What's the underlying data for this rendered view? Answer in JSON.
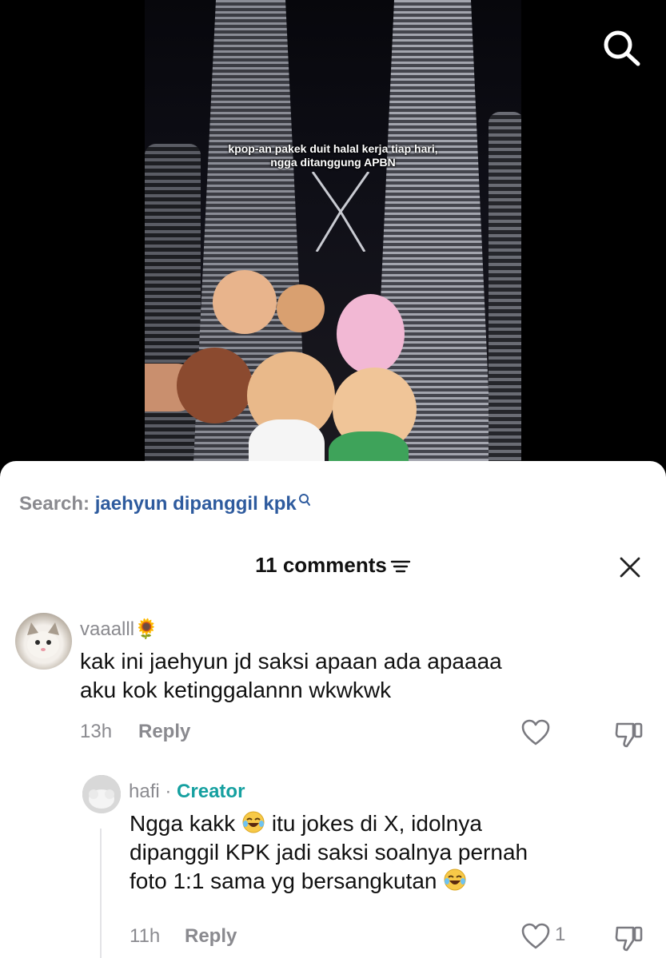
{
  "video": {
    "caption_line1": "kpop-an pakek duit halal kerja tiap hari,",
    "caption_line2": "ngga ditanggung APBN"
  },
  "search": {
    "prefix": "Search:",
    "query": "jaehyun dipanggil kpk"
  },
  "comments_header": {
    "title": "11 comments"
  },
  "comments": [
    {
      "username": "vaaalll",
      "username_emoji": "🌻",
      "text_line1": "kak ini jaehyun jd saksi apaan ada apaaaa",
      "text_line2": "aku kok ketinggalannn wkwkwk",
      "time": "13h",
      "reply_label": "Reply"
    },
    {
      "username": "hafi",
      "separator": "·",
      "badge": "Creator",
      "text_part1": "Ngga kakk",
      "text_part2": "itu jokes di X, idolnya",
      "text_line2": "dipanggil KPK jadi saksi soalnya pernah",
      "text_line3": "foto 1:1 sama yg bersangkutan",
      "time": "11h",
      "reply_label": "Reply",
      "like_count": "1"
    }
  ],
  "icons": {
    "search": "search-icon",
    "filter": "sort-lines-icon",
    "close": "close-icon",
    "like": "heart-outline-icon",
    "dislike": "thumbs-down-outline-icon",
    "emoji": "face-with-tears-of-joy"
  },
  "colors": {
    "link": "#2e5b9e",
    "creator_badge": "#15a0a0",
    "muted": "#8a8a8f",
    "text": "#111111"
  }
}
